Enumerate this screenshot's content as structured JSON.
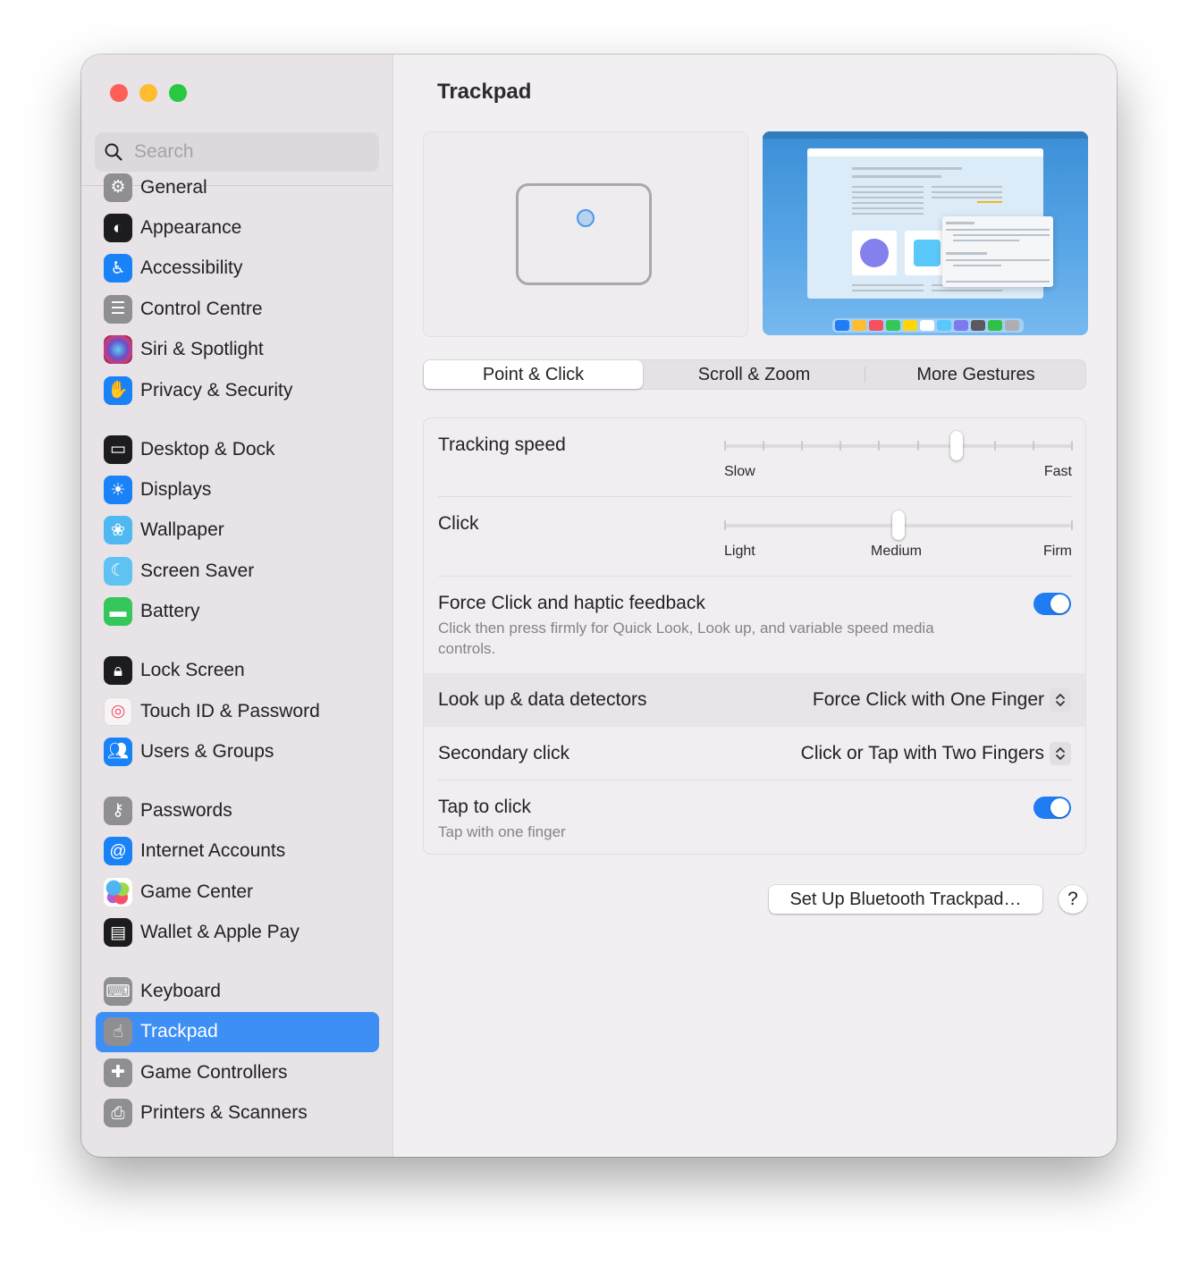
{
  "window": {
    "traffic_lights": [
      "close",
      "minimize",
      "zoom"
    ]
  },
  "sidebar": {
    "search": {
      "placeholder": "Search",
      "value": ""
    },
    "items": [
      {
        "label": "General",
        "icon": "gear-icon",
        "color": "#8e8e93",
        "selected": false,
        "gap_before": false
      },
      {
        "label": "Appearance",
        "icon": "appearance-icon",
        "color": "#1c1c1e",
        "selected": false,
        "gap_before": false
      },
      {
        "label": "Accessibility",
        "icon": "accessibility-icon",
        "color": "#1a82f7",
        "selected": false,
        "gap_before": false
      },
      {
        "label": "Control Centre",
        "icon": "control-centre-icon",
        "color": "#8e8e93",
        "selected": false,
        "gap_before": false
      },
      {
        "label": "Siri & Spotlight",
        "icon": "siri-icon",
        "color": "#3a2a4a",
        "selected": false,
        "gap_before": false
      },
      {
        "label": "Privacy & Security",
        "icon": "hand-icon",
        "color": "#1a82f7",
        "selected": false,
        "gap_before": false
      },
      {
        "label": "Desktop & Dock",
        "icon": "dock-icon",
        "color": "#1c1c1e",
        "selected": false,
        "gap_before": true
      },
      {
        "label": "Displays",
        "icon": "sun-icon",
        "color": "#1a82f7",
        "selected": false,
        "gap_before": false
      },
      {
        "label": "Wallpaper",
        "icon": "flower-icon",
        "color": "#4fb8f0",
        "selected": false,
        "gap_before": false
      },
      {
        "label": "Screen Saver",
        "icon": "screen-saver-icon",
        "color": "#5ec2f2",
        "selected": false,
        "gap_before": false
      },
      {
        "label": "Battery",
        "icon": "battery-icon",
        "color": "#34c759",
        "selected": false,
        "gap_before": false
      },
      {
        "label": "Lock Screen",
        "icon": "lock-icon",
        "color": "#1c1c1e",
        "selected": false,
        "gap_before": true
      },
      {
        "label": "Touch ID & Password",
        "icon": "fingerprint-icon",
        "color": "#f7f4f6",
        "selected": false,
        "gap_before": false
      },
      {
        "label": "Users & Groups",
        "icon": "users-icon",
        "color": "#1a82f7",
        "selected": false,
        "gap_before": false
      },
      {
        "label": "Passwords",
        "icon": "key-icon",
        "color": "#8e8e93",
        "selected": false,
        "gap_before": true
      },
      {
        "label": "Internet Accounts",
        "icon": "at-icon",
        "color": "#1a82f7",
        "selected": false,
        "gap_before": false
      },
      {
        "label": "Game Center",
        "icon": "game-center-icon",
        "color": "#ffffff",
        "selected": false,
        "gap_before": false
      },
      {
        "label": "Wallet & Apple Pay",
        "icon": "wallet-icon",
        "color": "#1c1c1e",
        "selected": false,
        "gap_before": false
      },
      {
        "label": "Keyboard",
        "icon": "keyboard-icon",
        "color": "#8e8e93",
        "selected": false,
        "gap_before": true
      },
      {
        "label": "Trackpad",
        "icon": "trackpad-icon",
        "color": "#8e8e93",
        "selected": true,
        "gap_before": false
      },
      {
        "label": "Game Controllers",
        "icon": "gamepad-icon",
        "color": "#8e8e93",
        "selected": false,
        "gap_before": false
      },
      {
        "label": "Printers & Scanners",
        "icon": "printer-icon",
        "color": "#8e8e93",
        "selected": false,
        "gap_before": false
      }
    ]
  },
  "main": {
    "title": "Trackpad",
    "tabs": [
      {
        "label": "Point & Click",
        "active": true
      },
      {
        "label": "Scroll & Zoom",
        "active": false
      },
      {
        "label": "More Gestures",
        "active": false
      }
    ],
    "settings": {
      "tracking_speed": {
        "label": "Tracking speed",
        "min_label": "Slow",
        "max_label": "Fast",
        "ticks": 10,
        "value_index": 6
      },
      "click": {
        "label": "Click",
        "labels": [
          "Light",
          "Medium",
          "Firm"
        ],
        "ticks": 3,
        "value_index": 1
      },
      "force_click": {
        "label": "Force Click and haptic feedback",
        "description": "Click then press firmly for Quick Look, Look up, and variable speed media controls.",
        "enabled": true
      },
      "look_up": {
        "label": "Look up & data detectors",
        "value": "Force Click with One Finger"
      },
      "secondary_click": {
        "label": "Secondary click",
        "value": "Click or Tap with Two Fingers"
      },
      "tap_to_click": {
        "label": "Tap to click",
        "description": "Tap with one finger",
        "enabled": true
      }
    },
    "buttons": {
      "bluetooth": "Set Up Bluetooth Trackpad…",
      "help": "?"
    },
    "accent_color": "#1f7cf3",
    "selection_color": "#3d8ff5",
    "preview_dock_colors": [
      "#1f7cf3",
      "#febc2e",
      "#f5515f",
      "#34c759",
      "#ffd60a",
      "#ffffff",
      "#5ac8fa",
      "#7d7aef",
      "#5a5a5e",
      "#30c048",
      "#aeaeb2"
    ]
  }
}
